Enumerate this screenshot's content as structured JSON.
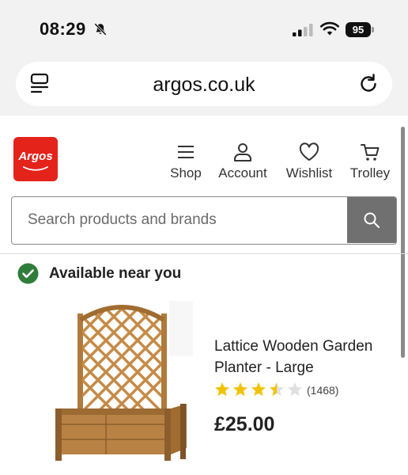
{
  "status_bar": {
    "time": "08:29",
    "battery": "95",
    "icons": [
      "bell-muted-icon",
      "signal-icon",
      "wifi-icon",
      "battery-icon"
    ]
  },
  "browser": {
    "url": "argos.co.uk",
    "icons": [
      "tabs-icon",
      "reload-icon"
    ]
  },
  "header": {
    "logo_text": "Argos",
    "brand_color": "#e4231b",
    "nav": {
      "shop": "Shop",
      "account": "Account",
      "wishlist": "Wishlist",
      "trolley": "Trolley"
    },
    "nav_icons": [
      "menu-icon",
      "account-icon",
      "heart-icon",
      "trolley-icon"
    ]
  },
  "search": {
    "placeholder": "Search products and brands",
    "value": ""
  },
  "availability": {
    "text": "Available near you",
    "color": "#2e7d3a"
  },
  "product": {
    "title": "Lattice Wooden Garden Planter - Large",
    "rating": 3.5,
    "rating_max": 5,
    "review_count": "(1468)",
    "price": "£25.00",
    "star_color": "#f2c200"
  }
}
